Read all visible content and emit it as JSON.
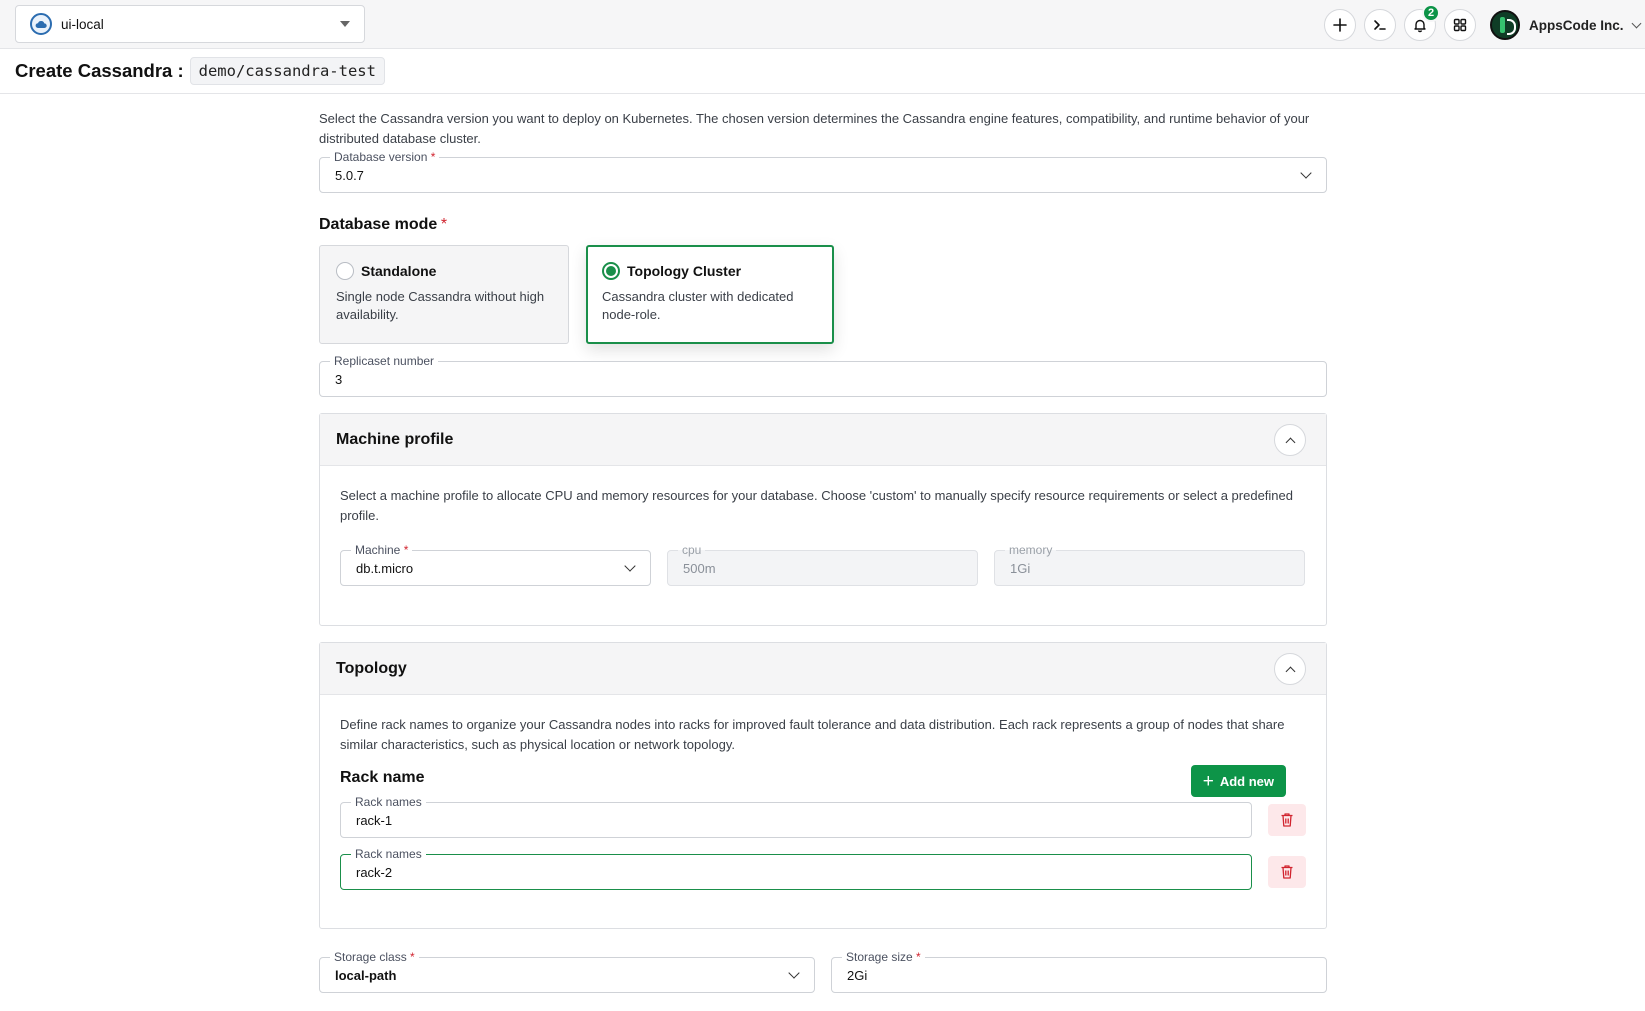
{
  "topbar": {
    "cluster": "ui-local",
    "notifications_count": "2",
    "org_name": "AppsCode Inc."
  },
  "header": {
    "title": "Create Cassandra :",
    "resource": "demo/cassandra-test"
  },
  "version": {
    "description": "Select the Cassandra version you want to deploy on Kubernetes. The chosen version determines the Cassandra engine features, compatibility, and runtime behavior of your distributed database cluster.",
    "label": "Database version",
    "value": "5.0.7"
  },
  "mode": {
    "label": "Database mode",
    "options": [
      {
        "title": "Standalone",
        "description": "Single node Cassandra without high availability."
      },
      {
        "title": "Topology Cluster",
        "description": "Cassandra cluster with dedicated node-role."
      }
    ],
    "selected": "Topology Cluster"
  },
  "replicaset": {
    "label": "Replicaset number",
    "value": "3"
  },
  "machine_profile": {
    "title": "Machine profile",
    "description": "Select a machine profile to allocate CPU and memory resources for your database. Choose 'custom' to manually specify resource requirements or select a predefined profile.",
    "machine_label": "Machine",
    "machine_value": "db.t.micro",
    "cpu_label": "cpu",
    "cpu_value": "500m",
    "memory_label": "memory",
    "memory_value": "1Gi"
  },
  "topology": {
    "title": "Topology",
    "description": "Define rack names to organize your Cassandra nodes into racks for improved fault tolerance and data distribution. Each rack represents a group of nodes that share similar characteristics, such as physical location or network topology.",
    "rack_heading": "Rack name",
    "add_label": "Add new",
    "racks": [
      {
        "label": "Rack names",
        "value": "rack-1"
      },
      {
        "label": "Rack names",
        "value": "rack-2"
      }
    ]
  },
  "storage": {
    "class_label": "Storage class",
    "class_value": "local-path",
    "size_label": "Storage size",
    "size_value": "2Gi"
  },
  "colors": {
    "accent": "#0d9448",
    "danger": "#d1242f"
  }
}
